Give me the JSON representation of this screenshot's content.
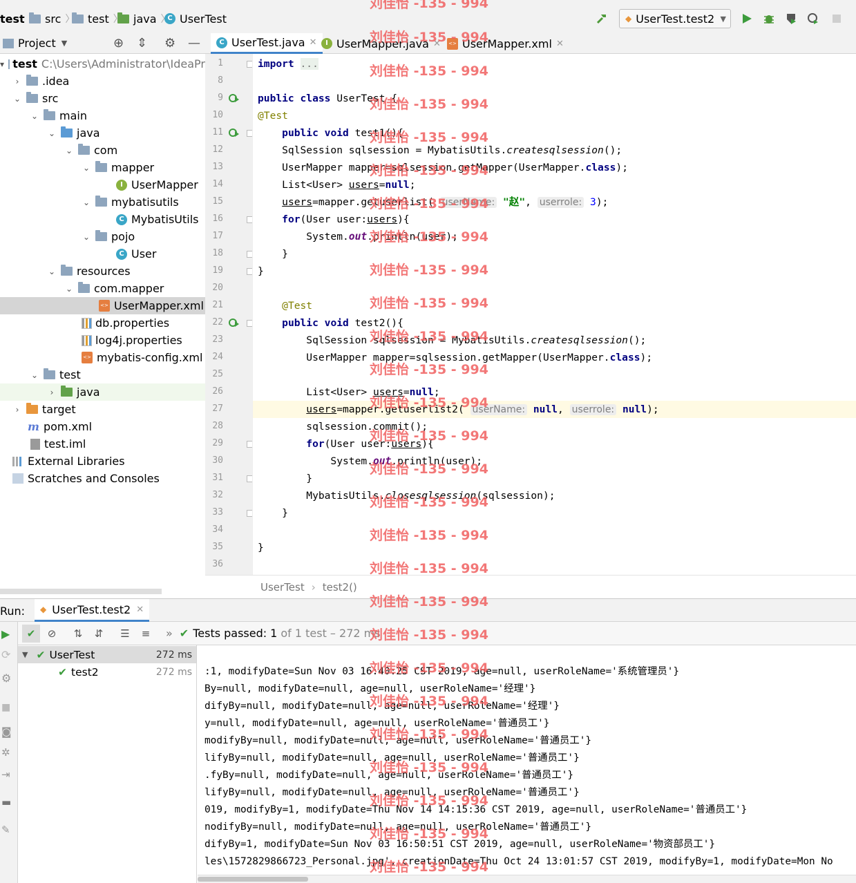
{
  "breadcrumb": [
    "test",
    "src",
    "test",
    "java",
    "UserTest"
  ],
  "run_config": "UserTest.test2",
  "project_panel": {
    "title": "Project"
  },
  "tree": [
    {
      "label": "test",
      "extra": "C:\\Users\\Administrator\\IdeaPr",
      "icon": "module"
    },
    {
      "label": ".idea",
      "icon": "folder"
    },
    {
      "label": "src",
      "icon": "folder"
    },
    {
      "label": "main",
      "icon": "folder"
    },
    {
      "label": "java",
      "icon": "folder-blue"
    },
    {
      "label": "com",
      "icon": "package"
    },
    {
      "label": "mapper",
      "icon": "package"
    },
    {
      "label": "UserMapper",
      "icon": "interface"
    },
    {
      "label": "mybatisutils",
      "icon": "package"
    },
    {
      "label": "MybatisUtils",
      "icon": "class"
    },
    {
      "label": "pojo",
      "icon": "package"
    },
    {
      "label": "User",
      "icon": "class"
    },
    {
      "label": "resources",
      "icon": "resources"
    },
    {
      "label": "com.mapper",
      "icon": "package"
    },
    {
      "label": "UserMapper.xml",
      "icon": "xml"
    },
    {
      "label": "db.properties",
      "icon": "properties"
    },
    {
      "label": "log4j.properties",
      "icon": "properties"
    },
    {
      "label": "mybatis-config.xml",
      "icon": "xml"
    },
    {
      "label": "test",
      "icon": "folder"
    },
    {
      "label": "java",
      "icon": "folder-green"
    },
    {
      "label": "target",
      "icon": "folder-orange"
    },
    {
      "label": "pom.xml",
      "icon": "maven"
    },
    {
      "label": "test.iml",
      "icon": "iml"
    },
    {
      "label": "External Libraries",
      "icon": "libraries"
    },
    {
      "label": "Scratches and Consoles",
      "icon": "scratches"
    }
  ],
  "tabs": [
    {
      "label": "UserTest.java",
      "active": true
    },
    {
      "label": "UserMapper.java",
      "active": false
    },
    {
      "label": "UserMapper.xml",
      "active": false
    }
  ],
  "line_numbers": [
    "1",
    "8",
    "9",
    "10",
    "11",
    "12",
    "13",
    "14",
    "15",
    "16",
    "17",
    "18",
    "19",
    "20",
    "21",
    "22",
    "23",
    "24",
    "25",
    "26",
    "27",
    "28",
    "29",
    "30",
    "31",
    "32",
    "33",
    "34",
    "35",
    "36"
  ],
  "code": {
    "import_kw": "import",
    "import_dots": "...",
    "hint_username": "userName:",
    "hint_userrole": "userrole:",
    "str_zhao": "\"赵\"",
    "num_3": "3"
  },
  "editor_breadcrumb": [
    "UserTest",
    "test2()"
  ],
  "run": {
    "label": "Run:",
    "tab": "UserTest.test2",
    "status_prefix": "Tests passed:",
    "status_count": "1",
    "status_suffix": "of 1 test – 272 ms",
    "tests": [
      {
        "name": "UserTest",
        "time": "272 ms"
      },
      {
        "name": "test2",
        "time": "272 ms"
      }
    ]
  },
  "console_lines": [
    ":1, modifyDate=Sun Nov 03 16:40:25 CST 2019, age=null, userRoleName='系统管理员'}",
    "By=null, modifyDate=null, age=null, userRoleName='经理'}",
    "difyBy=null, modifyDate=null, age=null, userRoleName='经理'}",
    "y=null, modifyDate=null, age=null, userRoleName='普通员工'}",
    "modifyBy=null, modifyDate=null, age=null, userRoleName='普通员工'}",
    "lifyBy=null, modifyDate=null, age=null, userRoleName='普通员工'}",
    ".fyBy=null, modifyDate=null, age=null, userRoleName='普通员工'}",
    "lifyBy=null, modifyDate=null, age=null, userRoleName='普通员工'}",
    "019, modifyBy=1, modifyDate=Thu Nov 14 14:15:36 CST 2019, age=null, userRoleName='普通员工'}",
    "nodifyBy=null, modifyDate=null, age=null, userRoleName='普通员工'}",
    "difyBy=1, modifyDate=Sun Nov 03 16:50:51 CST 2019, age=null, userRoleName='物资部员工'}",
    "les\\1572829866723_Personal.jpg', creationDate=Thu Oct 24 13:01:57 CST 2019, modifyBy=1, modifyDate=Mon No"
  ],
  "watermark": "刘佳怡 -135 - 994"
}
